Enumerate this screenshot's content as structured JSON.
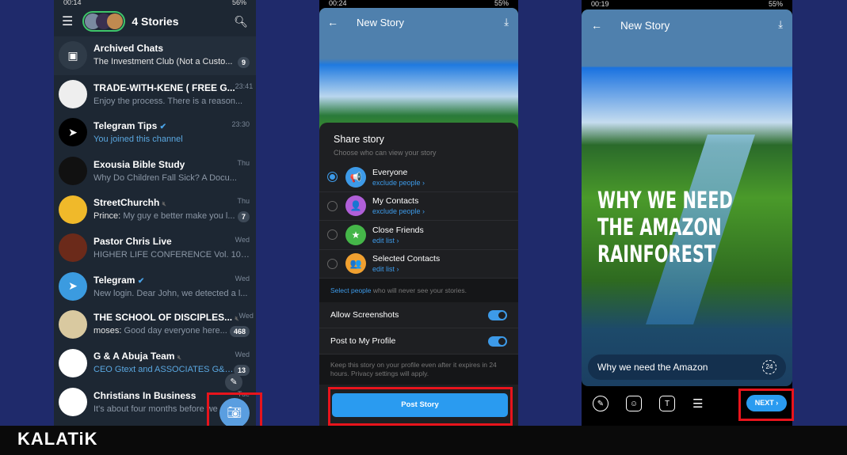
{
  "phone1": {
    "status_time": "00:14",
    "battery": "56%",
    "title": "4 Stories",
    "chats": [
      {
        "name": "Archived Chats",
        "preview": "The Investment Club (Not a Custo...",
        "time": "",
        "badge": "9",
        "preview_style": "white",
        "avatar_color": "#2f3b48"
      },
      {
        "name": "TRADE-WITH-KENE ( FREE G...",
        "preview": "Enjoy the process.  There is a reason...",
        "time": "23:41",
        "badge": "",
        "preview_style": "grey",
        "avatar_color": "#eeeeee"
      },
      {
        "name": "Telegram Tips",
        "verified": true,
        "preview": "You joined this channel",
        "time": "23:30",
        "badge": "",
        "preview_style": "blue",
        "avatar_color": "#000000"
      },
      {
        "name": "Exousia Bible Study",
        "preview": "Why Do Children Fall Sick?  A Docu...",
        "time": "Thu",
        "badge": "",
        "preview_style": "grey",
        "avatar_color": "#111111"
      },
      {
        "name": "StreetChurchh",
        "muted": true,
        "sender": "Prince:",
        "preview": "My guy e better make you l...",
        "time": "Thu",
        "badge": "7",
        "preview_style": "grey",
        "avatar_color": "#f0b92a"
      },
      {
        "name": "Pastor Chris Live",
        "preview": "HIGHER LIFE CONFERENCE Vol. 10 Pa...",
        "time": "Wed",
        "badge": "",
        "preview_style": "grey",
        "avatar_color": "#6b2a1a"
      },
      {
        "name": "Telegram",
        "verified": true,
        "preview": "New login. Dear John, we detected a l...",
        "time": "Wed",
        "badge": "",
        "preview_style": "grey",
        "avatar_color": "#3b9be0"
      },
      {
        "name": "THE SCHOOL OF DISCIPLES...",
        "muted": true,
        "sender": "moses:",
        "preview": "Good day everyone here...",
        "time": "Wed",
        "badge": "468",
        "preview_style": "grey",
        "avatar_color": "#d9c9a0"
      },
      {
        "name": "G & A Abuja Team",
        "muted": true,
        "preview": "CEO Gtext and ASSOCIATES G&A...",
        "time": "Wed",
        "badge": "13",
        "preview_style": "blue",
        "avatar_color": "#ffffff"
      },
      {
        "name": "Christians In Business",
        "preview": "It's about four months before we s...",
        "time": "Tue",
        "badge": "",
        "preview_style": "grey",
        "avatar_color": "#ffffff"
      }
    ]
  },
  "phone2": {
    "status_time": "00:24",
    "battery": "55%",
    "title": "New Story",
    "sheet_title": "Share story",
    "sheet_subtitle": "Choose who can view your story",
    "options": [
      {
        "label": "Everyone",
        "sub": "exclude people ›",
        "selected": true,
        "color": "#3d9ae8",
        "icon": "megaphone-icon",
        "glyph": "📢"
      },
      {
        "label": "My Contacts",
        "sub": "exclude people ›",
        "selected": false,
        "color": "#b05fd8",
        "icon": "person-icon",
        "glyph": "👤"
      },
      {
        "label": "Close Friends",
        "sub": "edit list ›",
        "selected": false,
        "color": "#45b649",
        "icon": "star-icon",
        "glyph": "★"
      },
      {
        "label": "Selected Contacts",
        "sub": "edit list ›",
        "selected": false,
        "color": "#f0a030",
        "icon": "group-icon",
        "glyph": "👥"
      }
    ],
    "hint_link": "Select people",
    "hint_rest": " who will never see your stories.",
    "toggles": [
      {
        "label": "Allow Screenshots",
        "on": true
      },
      {
        "label": "Post to My Profile",
        "on": true
      }
    ],
    "footnote": "Keep this story on your profile even after it expires in 24 hours. Privacy settings will apply.",
    "post_button": "Post Story"
  },
  "phone3": {
    "status_time": "00:19",
    "battery": "55%",
    "title": "New Story",
    "headline": [
      "WHY WE  NEED",
      "THE AMAZON",
      "RAINFOREST"
    ],
    "caption": "Why we need the Amazon",
    "timer": "24",
    "next_button": "NEXT ›"
  },
  "logo": "KALATiK",
  "colors": {
    "accent": "#3d9ae8",
    "highlight": "#e8141c",
    "background": "#1f2a6b"
  }
}
